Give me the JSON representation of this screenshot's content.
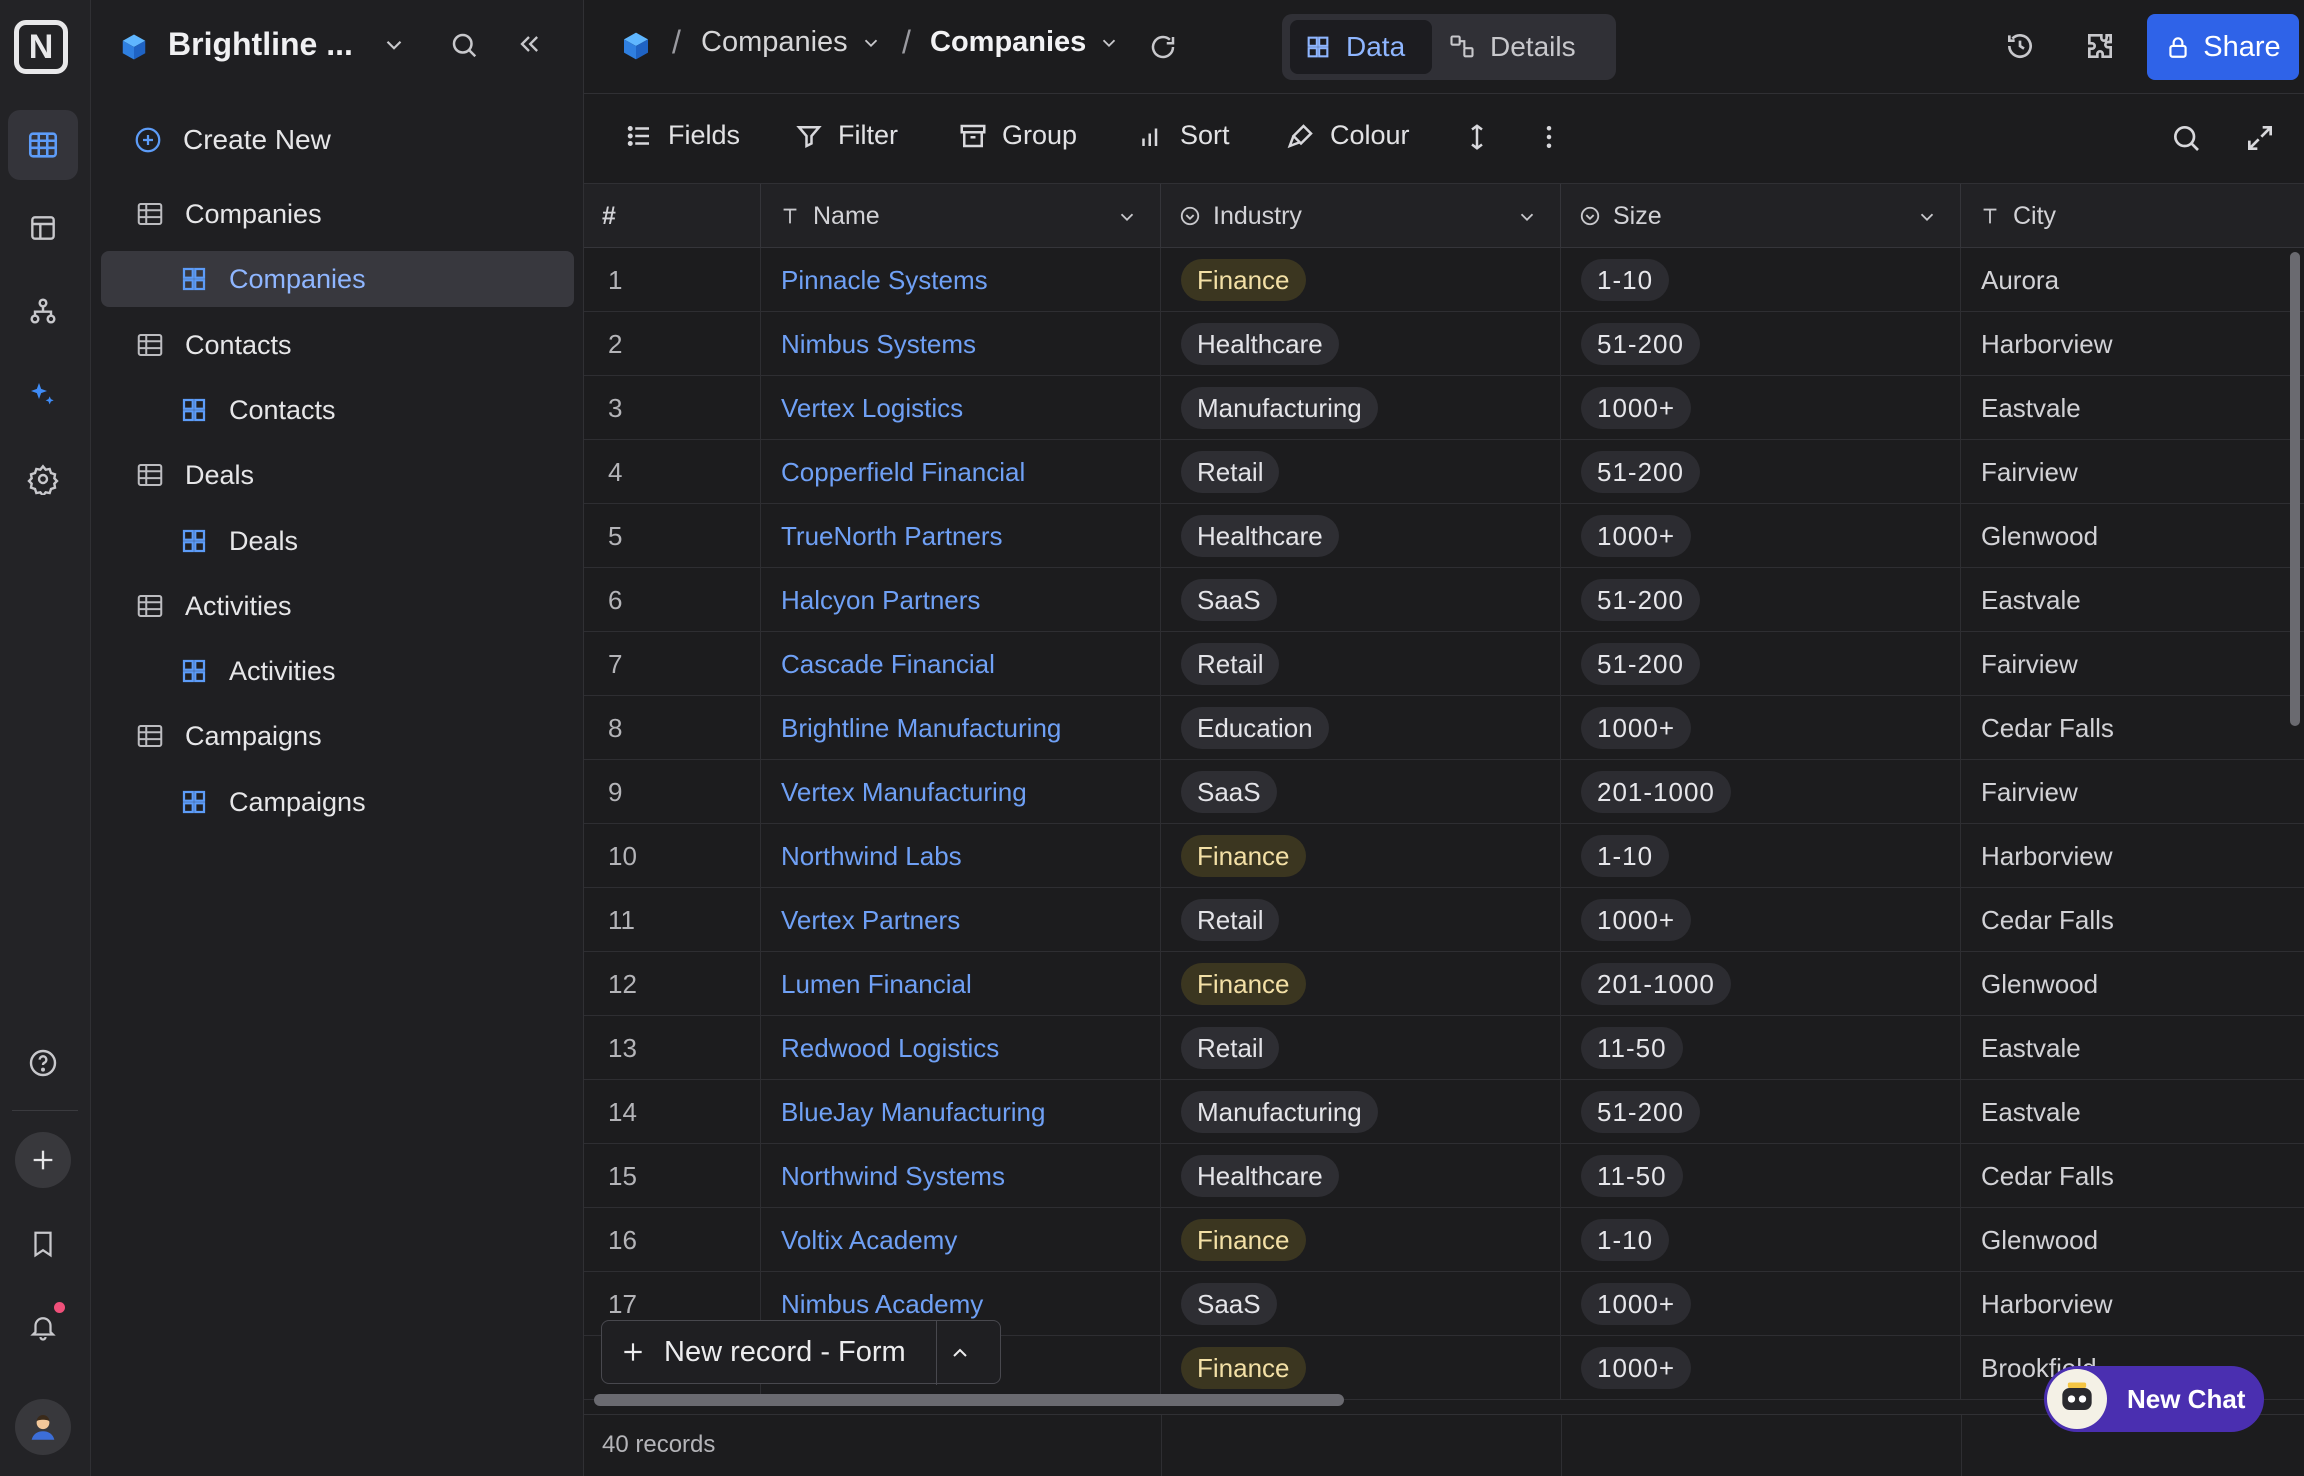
{
  "workspace": {
    "name": "Brightline ..."
  },
  "sidebar": {
    "create_label": "Create New",
    "items": [
      {
        "label": "Companies",
        "level": 0
      },
      {
        "label": "Companies",
        "level": 1,
        "selected": true
      },
      {
        "label": "Contacts",
        "level": 0
      },
      {
        "label": "Contacts",
        "level": 1
      },
      {
        "label": "Deals",
        "level": 0
      },
      {
        "label": "Deals",
        "level": 1
      },
      {
        "label": "Activities",
        "level": 0
      },
      {
        "label": "Activities",
        "level": 1
      },
      {
        "label": "Campaigns",
        "level": 0
      },
      {
        "label": "Campaigns",
        "level": 1
      }
    ]
  },
  "breadcrumb": {
    "table": "Companies",
    "view": "Companies"
  },
  "view_switch": {
    "data_label": "Data",
    "details_label": "Details"
  },
  "share_label": "Share",
  "toolbar": {
    "fields": "Fields",
    "filter": "Filter",
    "group": "Group",
    "sort": "Sort",
    "colour": "Colour"
  },
  "columns": {
    "num": "#",
    "name": "Name",
    "industry": "Industry",
    "size": "Size",
    "city": "City"
  },
  "rows": [
    {
      "id": "1",
      "name": "Pinnacle Systems",
      "industry": "Finance",
      "size": "1-10",
      "city": "Aurora"
    },
    {
      "id": "2",
      "name": "Nimbus Systems",
      "industry": "Healthcare",
      "size": "51-200",
      "city": "Harborview"
    },
    {
      "id": "3",
      "name": "Vertex Logistics",
      "industry": "Manufacturing",
      "size": "1000+",
      "city": "Eastvale"
    },
    {
      "id": "4",
      "name": "Copperfield Financial",
      "industry": "Retail",
      "size": "51-200",
      "city": "Fairview"
    },
    {
      "id": "5",
      "name": "TrueNorth Partners",
      "industry": "Healthcare",
      "size": "1000+",
      "city": "Glenwood"
    },
    {
      "id": "6",
      "name": "Halcyon Partners",
      "industry": "SaaS",
      "size": "51-200",
      "city": "Eastvale"
    },
    {
      "id": "7",
      "name": "Cascade Financial",
      "industry": "Retail",
      "size": "51-200",
      "city": "Fairview"
    },
    {
      "id": "8",
      "name": "Brightline Manufacturing",
      "industry": "Education",
      "size": "1000+",
      "city": "Cedar Falls"
    },
    {
      "id": "9",
      "name": "Vertex Manufacturing",
      "industry": "SaaS",
      "size": "201-1000",
      "city": "Fairview"
    },
    {
      "id": "10",
      "name": "Northwind Labs",
      "industry": "Finance",
      "size": "1-10",
      "city": "Harborview"
    },
    {
      "id": "11",
      "name": "Vertex Partners",
      "industry": "Retail",
      "size": "1000+",
      "city": "Cedar Falls"
    },
    {
      "id": "12",
      "name": "Lumen Financial",
      "industry": "Finance",
      "size": "201-1000",
      "city": "Glenwood"
    },
    {
      "id": "13",
      "name": "Redwood Logistics",
      "industry": "Retail",
      "size": "11-50",
      "city": "Eastvale"
    },
    {
      "id": "14",
      "name": "BlueJay Manufacturing",
      "industry": "Manufacturing",
      "size": "51-200",
      "city": "Eastvale"
    },
    {
      "id": "15",
      "name": "Northwind Systems",
      "industry": "Healthcare",
      "size": "11-50",
      "city": "Cedar Falls"
    },
    {
      "id": "16",
      "name": "Voltix Academy",
      "industry": "Finance",
      "size": "1-10",
      "city": "Glenwood"
    },
    {
      "id": "17",
      "name": "Nimbus Academy",
      "industry": "SaaS",
      "size": "1000+",
      "city": "Harborview"
    },
    {
      "id": "",
      "name": "",
      "industry": "Finance",
      "size": "1000+",
      "city": "Brookfield"
    }
  ],
  "new_record": {
    "label": "New record - Form"
  },
  "footer": {
    "records": "40 records"
  },
  "chat": {
    "label": "New Chat"
  },
  "colors": {
    "accent": "#2f63e8",
    "link": "#6fa0f5",
    "chat": "#4a2fb0",
    "notification": "#f0507a"
  }
}
